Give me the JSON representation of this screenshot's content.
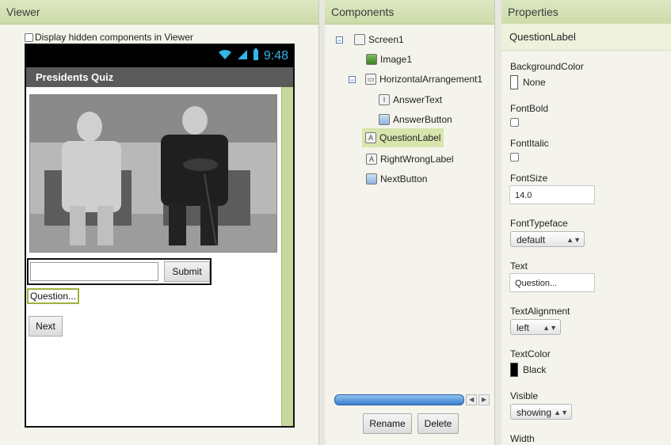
{
  "viewer": {
    "title": "Viewer",
    "hidden_toggle_label": "Display hidden components in Viewer",
    "phone": {
      "time": "9:48",
      "app_title": "Presidents Quiz",
      "submit_label": "Submit",
      "question_text": "Question...",
      "next_label": "Next"
    }
  },
  "components": {
    "title": "Components",
    "tree": [
      {
        "label": "Screen1",
        "icon": "screen-icon"
      },
      {
        "label": "Image1",
        "icon": "image-icon"
      },
      {
        "label": "HorizontalArrangement1",
        "icon": "arrangement-icon"
      },
      {
        "label": "AnswerText",
        "icon": "textbox-icon"
      },
      {
        "label": "AnswerButton",
        "icon": "button-icon"
      },
      {
        "label": "QuestionLabel",
        "icon": "label-icon",
        "selected": true
      },
      {
        "label": "RightWrongLabel",
        "icon": "label-icon"
      },
      {
        "label": "NextButton",
        "icon": "button-icon"
      }
    ],
    "rename_label": "Rename",
    "delete_label": "Delete"
  },
  "properties": {
    "title": "Properties",
    "component_name": "QuestionLabel",
    "background_color_label": "BackgroundColor",
    "background_color_value": "None",
    "font_bold_label": "FontBold",
    "font_italic_label": "FontItalic",
    "font_size_label": "FontSize",
    "font_size_value": "14.0",
    "font_typeface_label": "FontTypeface",
    "font_typeface_value": "default",
    "text_label": "Text",
    "text_value": "Question...",
    "text_alignment_label": "TextAlignment",
    "text_alignment_value": "left",
    "text_color_label": "TextColor",
    "text_color_value": "Black",
    "visible_label": "Visible",
    "visible_value": "showing",
    "width_label": "Width"
  },
  "colors": {
    "header_green": "#cddca9",
    "selection_green": "#d8e5ad",
    "android_blue": "#33b5e5"
  }
}
